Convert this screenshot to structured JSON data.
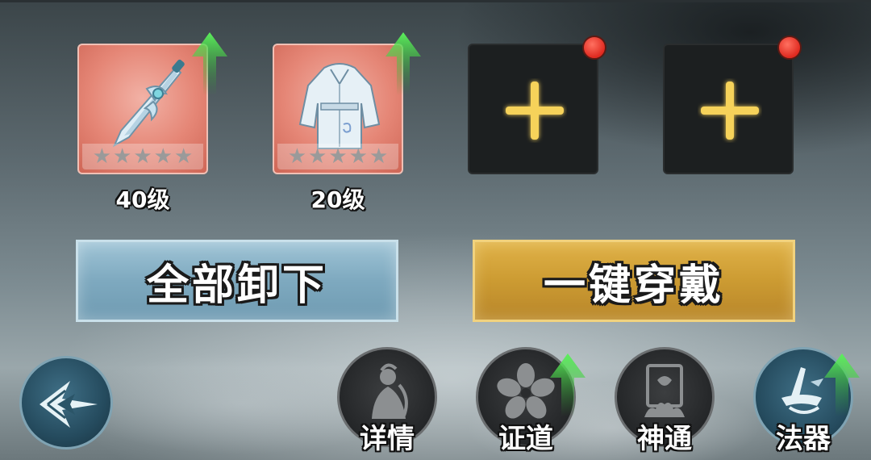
{
  "equipment": {
    "slots": [
      {
        "name": "weapon-slot",
        "state": "filled",
        "icon": "sword-icon",
        "level_label": "40级",
        "stars_filled": 0,
        "stars_total": 5,
        "upgrade_available": true
      },
      {
        "name": "armor-slot",
        "state": "filled",
        "icon": "robe-icon",
        "level_label": "20级",
        "stars_filled": 0,
        "stars_total": 5,
        "upgrade_available": true
      },
      {
        "name": "empty-slot-3",
        "state": "empty",
        "icon": "plus-icon",
        "notification": true
      },
      {
        "name": "empty-slot-4",
        "state": "empty",
        "icon": "plus-icon",
        "notification": true
      }
    ]
  },
  "actions": {
    "unequip_all_label": "全部卸下",
    "equip_all_label": "一键穿戴"
  },
  "nav": {
    "back_icon": "back-arrow-icon",
    "items": [
      {
        "label": "详情",
        "icon": "character-icon",
        "upgrade_available": false,
        "active": false
      },
      {
        "label": "证道",
        "icon": "flower-icon",
        "upgrade_available": true,
        "active": false
      },
      {
        "label": "神通",
        "icon": "shield-scroll-icon",
        "upgrade_available": false,
        "active": false
      },
      {
        "label": "法器",
        "icon": "magic-artifact-icon",
        "upgrade_available": true,
        "active": true
      }
    ]
  },
  "colors": {
    "filled_slot_bg": "#e58676",
    "empty_slot_bg": "#1c1f20",
    "unequip_button": "#7ea9bf",
    "equip_button": "#cc9b32",
    "upgrade_arrow": "#3ed13e",
    "notification_dot": "#e02a20",
    "plus_glow": "#f6d25a"
  }
}
